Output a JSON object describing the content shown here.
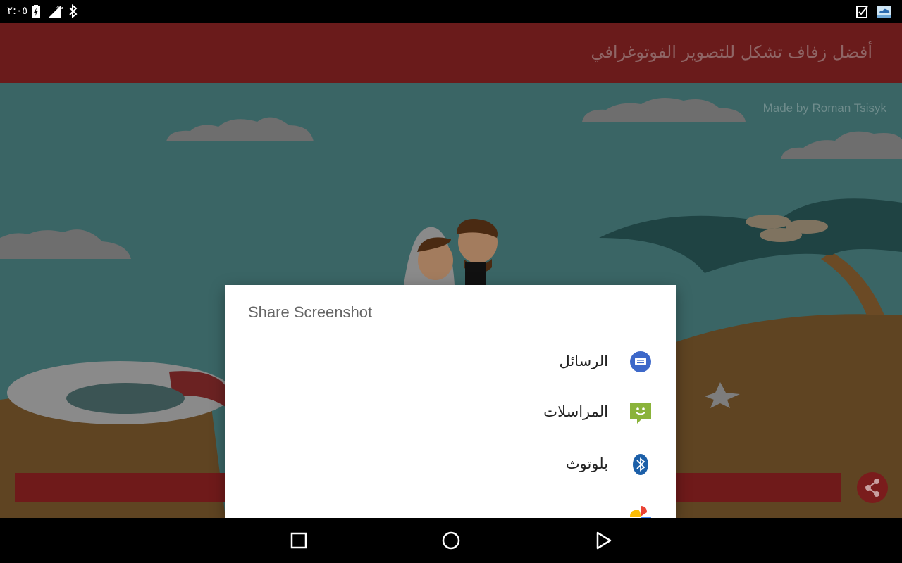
{
  "status_bar": {
    "time": "٢:٠٥",
    "icons": [
      "battery-charging-icon",
      "signal-4g-icon",
      "bluetooth-icon",
      "clipboard-check-icon",
      "cloud-app-icon"
    ],
    "network_label": "4G"
  },
  "app_bar": {
    "title": "أفضل زفاف تشكل للتصوير الفوتوغرافي",
    "color": "#6a1b1b"
  },
  "scene": {
    "credit": "Made by Roman Tsisyk",
    "sky_color": "#3a6565",
    "sand_color": "#7a5a30"
  },
  "share_dialog": {
    "title": "Share Screenshot",
    "items": [
      {
        "label": "الرسائل",
        "icon": "messages-icon"
      },
      {
        "label": "المراسلات",
        "icon": "messaging-icon"
      },
      {
        "label": "بلوتوث",
        "icon": "bluetooth-share-icon"
      },
      {
        "label": "",
        "icon": "photos-icon"
      }
    ]
  },
  "nav_bar": {
    "buttons": [
      "recents-button",
      "home-button",
      "back-button"
    ]
  }
}
